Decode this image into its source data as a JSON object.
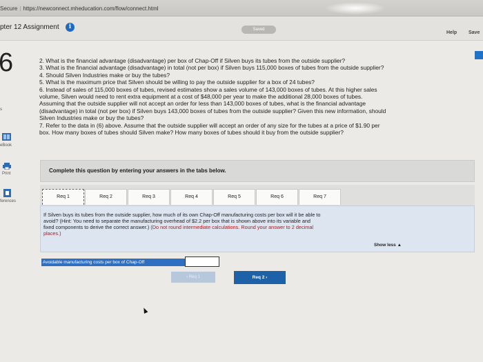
{
  "browser": {
    "secure_label": "Secure",
    "url": "https://newconnect.mheducation.com/flow/connect.html"
  },
  "header": {
    "assignment_title": "pter 12 Assignment",
    "info_icon": "i",
    "saved_label": "Saved",
    "help_label": "Help",
    "save_label": "Save"
  },
  "sidebar": {
    "question_number": "6",
    "frag_s": "s",
    "ebook_label": "eBook",
    "print_label": "Print",
    "references_label": "ferences"
  },
  "question": {
    "lines": [
      "2. What is the financial advantage (disadvantage) per box of Chap-Off if Silven buys its tubes from the outside supplier?",
      "3. What is the financial advantage (disadvantage) in total (not per box) if Silven buys 115,000 boxes of tubes from the outside supplier?",
      "4. Should Silven Industries make or buy the tubes?",
      "5. What is the maximum price that Silven should be willing to pay the outside supplier for a box of 24 tubes?",
      "6. Instead of sales of 115,000 boxes of tubes, revised estimates show a sales volume of 143,000 boxes of tubes. At this higher sales",
      "volume, Silven would need to rent extra equipment at a cost of $48,000 per year to make the additional 28,000 boxes of tubes.",
      "Assuming that the outside supplier will not accept an order for less than 143,000 boxes of tubes, what is the financial advantage",
      "(disadvantage) in total (not per box) if Silven buys 143,000 boxes of tubes from the outside supplier? Given this new information, should",
      "Silven Industries make or buy the tubes?",
      "7. Refer to the data in (6) above. Assume that the outside supplier will accept an order of any size for the tubes at a price of $1.90 per",
      "box. How many boxes of tubes should Silven make? How many boxes of tubes should it buy from the outside supplier?"
    ]
  },
  "instructions": "Complete this question by entering your answers in the tabs below.",
  "tabs": [
    "Req 1",
    "Req 2",
    "Req 3",
    "Req 4",
    "Req 5",
    "Req 6",
    "Req 7"
  ],
  "req_panel": {
    "line1": "If Silven buys its tubes from the outside supplier, how much of its own Chap-Off manufacturing costs per box will it be able to",
    "line2": "avoid? (Hint: You need to separate the manufacturing overhead of $2.2 per box that is shown above into its variable and",
    "line3_a": "fixed components to derive the correct answer.) ",
    "line3_b": "(Do not round intermediate calculations. Round your answer to 2 decimal",
    "line4": "places.)",
    "show_less": "Show less ▲"
  },
  "answer": {
    "label": "Avoidable manufacturing costs per box of Chap-Off",
    "value": ""
  },
  "nav": {
    "prev_label": "‹  Req 1",
    "next_label": "Req 2   ›"
  }
}
